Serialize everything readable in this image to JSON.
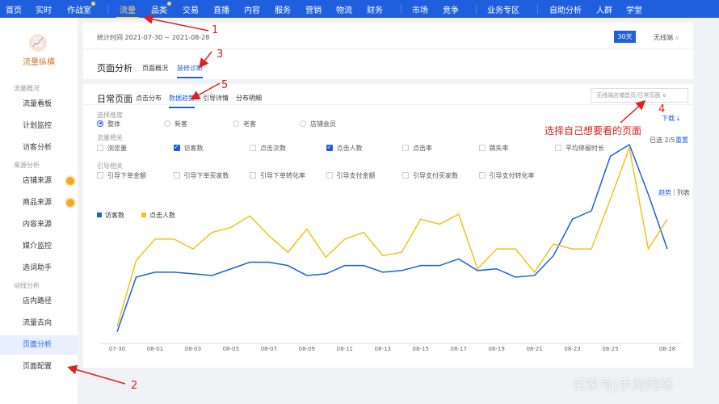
{
  "nav": {
    "items": [
      "首页",
      "实时",
      "作战室",
      "流量",
      "品类",
      "交易",
      "直播",
      "内容",
      "服务",
      "营销",
      "物流",
      "财务",
      "市场",
      "竞争",
      "业务专区",
      "自助分析",
      "人群",
      "学堂"
    ],
    "active": "流量"
  },
  "sidebar": {
    "logo_title": "流量纵横",
    "sections": [
      {
        "header": "流量概况",
        "items": [
          "流量看板",
          "计划监控",
          "访客分析"
        ]
      },
      {
        "header": "来源分析",
        "items": [
          "店铺来源",
          "商品来源",
          "内容来源",
          "媒介监控",
          "选词助手"
        ]
      },
      {
        "header": "动线分析",
        "items": [
          "店内路径",
          "流量去向",
          "页面分析",
          "页面配置"
        ]
      }
    ],
    "selected": "页面分析"
  },
  "header": {
    "stat_time": "统计时间 2021-07-30 ~ 2021-08-28",
    "range_button": "30天",
    "device_select": "无线端",
    "title": "页面分析",
    "tabs": [
      "页面概况",
      "装修诊断"
    ],
    "active_tab": "装修诊断"
  },
  "page": {
    "title": "日常页面",
    "tabs": [
      "点击分布",
      "数据趋势",
      "引导详情",
      "分布明细"
    ],
    "active_tab": "数据趋势",
    "page_select": "无线端店铺首页/日常页面",
    "download": "下载",
    "selected_count": "已选 2/5",
    "reset": "重置",
    "dimension_label": "选择维度",
    "dimensions": [
      "整体",
      "新客",
      "老客",
      "店铺会员"
    ],
    "traffic_label": "流量相关",
    "traffic_metrics": [
      {
        "label": "浏览量",
        "checked": false
      },
      {
        "label": "访客数",
        "checked": true
      },
      {
        "label": "点击次数",
        "checked": false
      },
      {
        "label": "点击人数",
        "checked": true
      },
      {
        "label": "点击率",
        "checked": false
      },
      {
        "label": "跳失率",
        "checked": false
      },
      {
        "label": "平均停留时长",
        "checked": false
      }
    ],
    "guide_label": "引导相关",
    "guide_metrics": [
      "引导下单金额",
      "引导下单买家数",
      "引导下单转化率",
      "引导支付金额",
      "引导支付买家数",
      "引导支付转化率"
    ],
    "view_trend": "趋势",
    "view_list": "列表"
  },
  "chart_data": {
    "type": "line",
    "x": [
      "07-30",
      "07-31",
      "08-01",
      "08-02",
      "08-03",
      "08-04",
      "08-05",
      "08-06",
      "08-07",
      "08-08",
      "08-09",
      "08-10",
      "08-11",
      "08-12",
      "08-13",
      "08-14",
      "08-15",
      "08-16",
      "08-17",
      "08-18",
      "08-19",
      "08-20",
      "08-21",
      "08-22",
      "08-23",
      "08-24",
      "08-25",
      "08-26",
      "08-27",
      "08-28"
    ],
    "tick_labels": [
      "07-30",
      "08-01",
      "08-03",
      "08-05",
      "08-07",
      "08-09",
      "08-11",
      "08-13",
      "08-15",
      "08-17",
      "08-19",
      "08-21",
      "08-23",
      "08-25",
      "08-28"
    ],
    "legend": "top-left",
    "grid": false,
    "series": [
      {
        "name": "访客数",
        "color": "#1f5fde",
        "values": [
          7,
          40,
          43,
          43,
          42,
          41,
          45,
          49,
          49,
          47,
          41,
          42,
          47,
          47,
          43,
          44,
          47,
          47,
          51,
          44,
          45,
          40,
          41,
          53,
          75,
          80,
          113,
          120,
          90,
          57
        ]
      },
      {
        "name": "点击人数",
        "color": "#f0c419",
        "values": [
          10,
          50,
          63,
          63,
          57,
          67,
          70,
          77,
          65,
          55,
          69,
          52,
          63,
          67,
          53,
          55,
          75,
          72,
          78,
          45,
          57,
          57,
          43,
          60,
          57,
          57,
          87,
          118,
          57,
          75
        ]
      }
    ]
  },
  "annotations": [
    "1",
    "2",
    "3",
    "4",
    "5",
    "选择自己想要看的页面"
  ],
  "watermark": "百家号|手淘网络"
}
